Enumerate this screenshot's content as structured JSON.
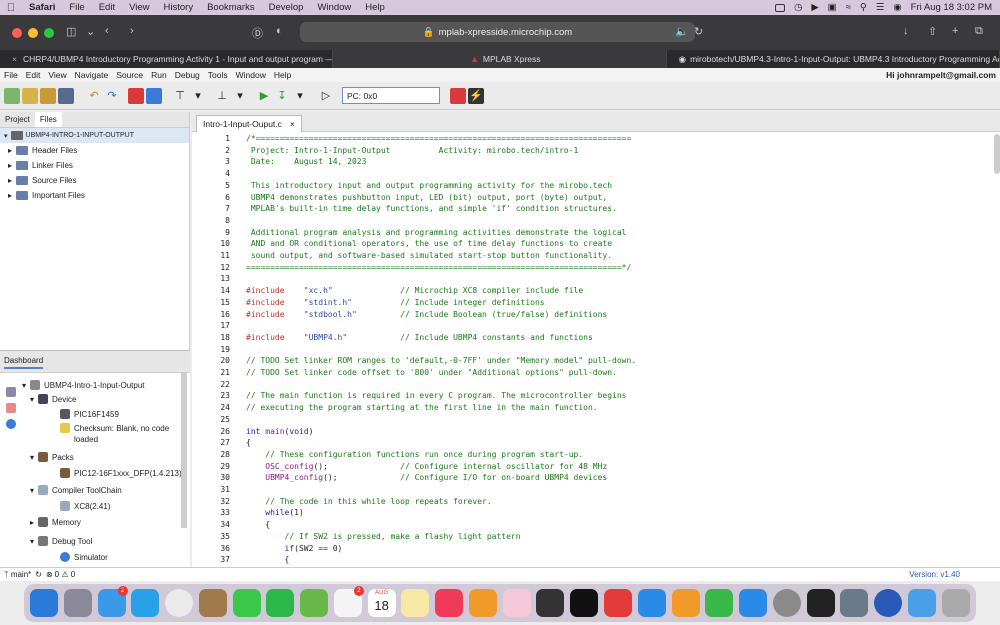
{
  "mac_menubar": {
    "app": "Safari",
    "items": [
      "File",
      "Edit",
      "View",
      "History",
      "Bookmarks",
      "Develop",
      "Window",
      "Help"
    ],
    "clock": "Fri Aug 18  3:02 PM"
  },
  "safari": {
    "url": "mplab-xpresside.microchip.com",
    "tabs": [
      {
        "label": "CHRP4/UBMP4 Introductory Programming Activity 1 - Input and output program — m...",
        "active": false
      },
      {
        "label": "MPLAB Xpress",
        "active": true
      },
      {
        "label": "mirobotech/UBMP4.3-Intro-1-Input-Output: UBMP4.3 Introductory Programming Acti...",
        "active": false
      }
    ]
  },
  "ide_menu": {
    "items": [
      "File",
      "Edit",
      "View",
      "Navigate",
      "Source",
      "Run",
      "Debug",
      "Tools",
      "Window",
      "Help"
    ],
    "user": "Hi johnrampelt@gmail.com"
  },
  "toolbar": {
    "pc": "PC: 0x0"
  },
  "project_panel": {
    "tabs": [
      "Project",
      "Files"
    ],
    "root": "UBMP4-INTRO-1-INPUT-OUTPUT",
    "folders": [
      "Header Files",
      "Linker Files",
      "Source Files",
      "Important Files"
    ]
  },
  "dashboard": {
    "tab": "Dashboard",
    "project": "UBMP4-Intro-1-Input-Output",
    "device_label": "Device",
    "device": "PIC16F1459",
    "checksum": "Checksum: Blank, no code loaded",
    "packs_label": "Packs",
    "pack": "PIC12-16F1xxx_DFP(1.4.213)",
    "toolchain_label": "Compiler ToolChain",
    "compiler": "XC8(2.41)",
    "memory_label": "Memory",
    "debug_label": "Debug Tool",
    "simulator": "Simulator"
  },
  "editor": {
    "file_tab": "Intro-1-Input-Ouput.c",
    "lines": [
      "/*==============================================================================",
      " Project: Intro-1-Input-Output          Activity: mirobo.tech/intro-1",
      " Date:    August 14, 2023",
      "",
      " This introductory input and output programming activity for the mirobo.tech",
      " UBMP4 demonstrates pushbutton input, LED (bit) output, port (byte) output,",
      " MPLAB's built-in time delay functions, and simple 'if' condition structures.",
      "",
      " Additional program analysis and programming activities demonstrate the logical",
      " AND and OR conditional operators, the use of time delay functions to create",
      " sound output, and software-based simulated start-stop button functionality.",
      "==============================================================================*/",
      "",
      "#include    \"xc.h\"              // Microchip XC8 compiler include file",
      "#include    \"stdint.h\"          // Include integer definitions",
      "#include    \"stdbool.h\"         // Include Boolean (true/false) definitions",
      "",
      "#include    \"UBMP4.h\"           // Include UBMP4 constants and functions",
      "",
      "// TODO Set linker ROM ranges to 'default,-0-7FF' under \"Memory model\" pull-down.",
      "// TODO Set linker code offset to '800' under \"Additional options\" pull-down.",
      "",
      "// The main function is required in every C program. The microcontroller begins",
      "// executing the program starting at the first line in the main function.",
      "",
      "int main(void)",
      "{",
      "    // These configuration functions run once during program start-up.",
      "    OSC_config();               // Configure internal oscillator for 48 MHz",
      "    UBMP4_config();             // Configure I/O for on-board UBMP4 devices",
      "",
      "    // The code in this while loop repeats forever.",
      "    while(1)",
      "    {",
      "        // If SW2 is pressed, make a flashy light pattern",
      "        if(SW2 == 0)",
      "        {"
    ]
  },
  "statusbar": {
    "branch": "main*",
    "counts": "0 ⚠ 0",
    "version": "Version: v1.40"
  },
  "dock": {
    "calendar_month": "AUG",
    "calendar_day": "18",
    "mail_badge": "2",
    "reminders_badge": "2"
  }
}
